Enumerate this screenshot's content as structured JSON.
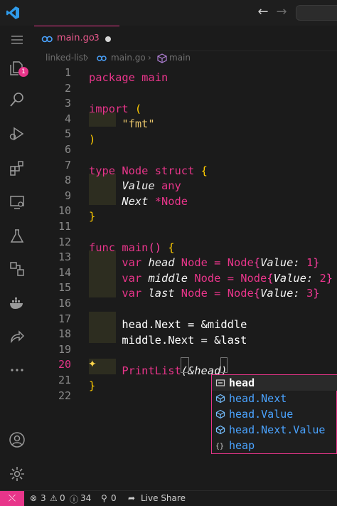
{
  "tab": {
    "filename": "main.go",
    "problems": "3"
  },
  "breadcrumb": {
    "folder": "linked-list",
    "file": "main.go",
    "symbol": "main"
  },
  "activity": {
    "scm_badge": "1"
  },
  "editor": {
    "active_line": 20,
    "line_numbers": [
      "1",
      "2",
      "3",
      "4",
      "5",
      "6",
      "7",
      "8",
      "9",
      "10",
      "11",
      "12",
      "13",
      "14",
      "15",
      "16",
      "17",
      "18",
      "19",
      "20",
      "21",
      "22"
    ]
  },
  "code": {
    "l1_kw": "package",
    "l1_name": "main",
    "l3_kw": "import",
    "l3_paren": "(",
    "l4_str": "\"fmt\"",
    "l5_paren": ")",
    "l7_kw": "type",
    "l7_name": "Node",
    "l7_struct": "struct",
    "l7_brace": "{",
    "l8_field": "Value",
    "l8_type": "any",
    "l9_field": "Next",
    "l9_type": "*Node",
    "l10_brace": "}",
    "l12_kw": "func",
    "l12_name": "main",
    "l12_parens": "()",
    "l12_brace": "{",
    "l13_kw": "var",
    "l13_var": "head",
    "l13_type": "Node",
    "l13_eq": "=",
    "l13_ctor": "Node",
    "l13_ob": "{",
    "l13_field": "Value:",
    "l13_val": "1",
    "l13_cb": "}",
    "l14_kw": "var",
    "l14_var": "middle",
    "l14_type": "Node",
    "l14_eq": "=",
    "l14_ctor": "Node",
    "l14_ob": "{",
    "l14_field": "Value:",
    "l14_val": "2",
    "l14_cb": "}",
    "l15_kw": "var",
    "l15_var": "last",
    "l15_type": "Node",
    "l15_eq": "=",
    "l15_ctor": "Node",
    "l15_ob": "{",
    "l15_field": "Value:",
    "l15_val": "3",
    "l15_cb": "}",
    "l17_text": "head.Next = &middle",
    "l18_text": "middle.Next = &last",
    "l20_fn": "PrintList",
    "l20_args": "(&head)",
    "l21_brace": "}"
  },
  "suggest": {
    "items": [
      {
        "label": "head",
        "icon": "variable-icon"
      },
      {
        "label": "head.Next",
        "icon": "field-icon"
      },
      {
        "label": "head.Value",
        "icon": "field-icon"
      },
      {
        "label": "head.Next.Value",
        "icon": "field-icon"
      },
      {
        "label": "heap",
        "icon": "module-icon"
      }
    ]
  },
  "status": {
    "errors": "3",
    "warnings": "0",
    "info": "34",
    "ports": "0",
    "live_share": "Live Share"
  },
  "colors": {
    "accent": "#e8358a",
    "string": "#e6c36a",
    "bracket": "#ffcc00",
    "suggest_text": "#4aa3ff"
  }
}
